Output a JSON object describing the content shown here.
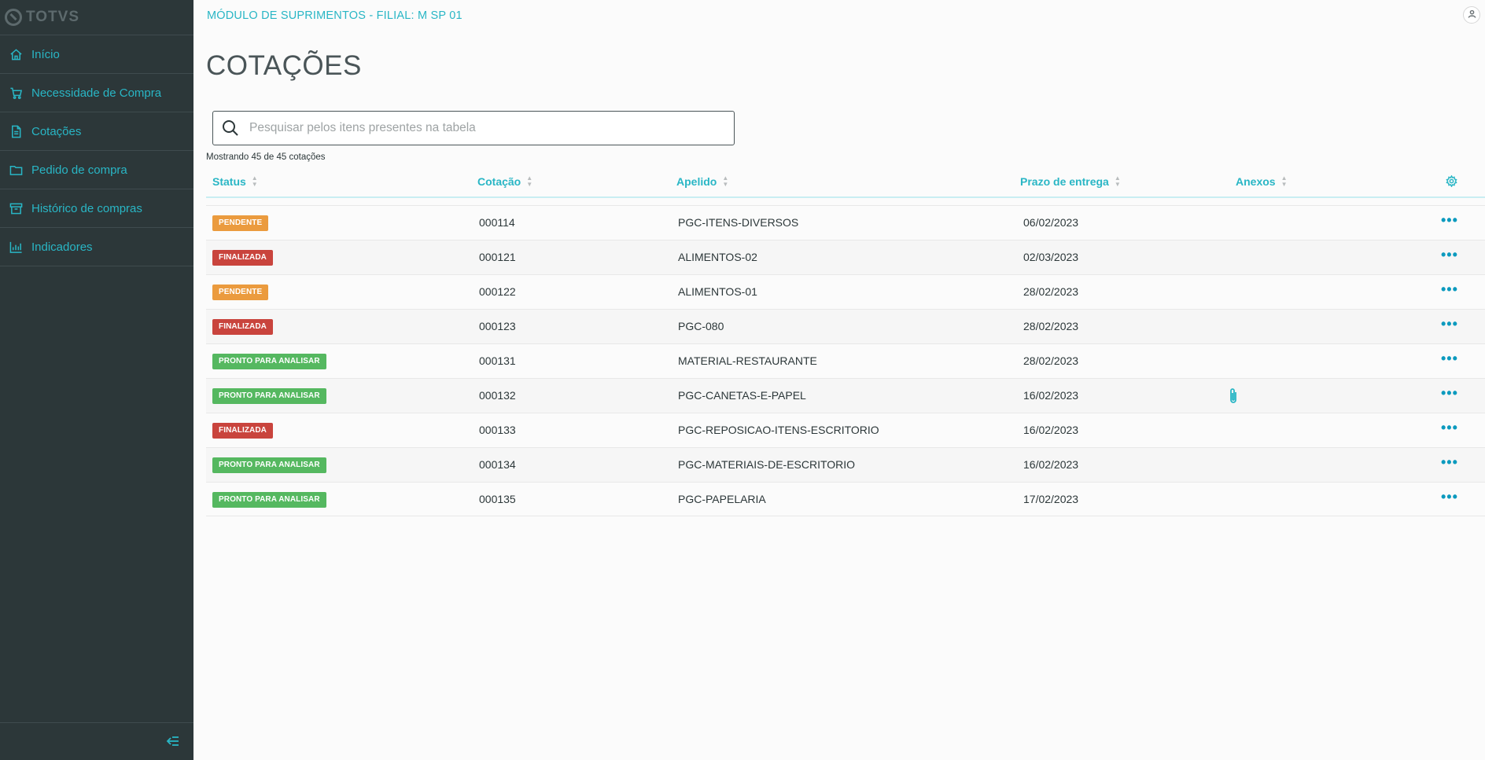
{
  "brand": {
    "name": "TOTVS"
  },
  "sidebar": {
    "items": [
      {
        "label": "Início",
        "icon": "home-icon"
      },
      {
        "label": "Necessidade de Compra",
        "icon": "cart-icon"
      },
      {
        "label": "Cotações",
        "icon": "document-icon"
      },
      {
        "label": "Pedido de compra",
        "icon": "folder-icon"
      },
      {
        "label": "Histórico de compras",
        "icon": "archive-icon"
      },
      {
        "label": "Indicadores",
        "icon": "bar-chart-icon"
      }
    ],
    "collapse_icon": "collapse-menu-icon"
  },
  "header": {
    "title": "MÓDULO DE SUPRIMENTOS - FILIAL: M SP 01",
    "user_icon": "user-icon"
  },
  "page": {
    "title": "COTAÇÕES",
    "search_placeholder": "Pesquisar pelos itens presentes na tabela",
    "search_value": "",
    "count_text": "Mostrando 45 de 45 cotações"
  },
  "table": {
    "columns": [
      "Status",
      "Cotação",
      "Apelido",
      "Prazo de entrega",
      "Anexos"
    ],
    "status_colors": {
      "PENDENTE": "#eb9b3e",
      "FINALIZADA": "#c9443d",
      "PRONTO PARA ANALISAR": "#55b860"
    },
    "rows": [
      {
        "status": "PENDENTE",
        "cotacao": "000114",
        "apelido": "PGC-ITENS-DIVERSOS",
        "prazo": "06/02/2023",
        "anexo": false
      },
      {
        "status": "FINALIZADA",
        "cotacao": "000121",
        "apelido": "ALIMENTOS-02",
        "prazo": "02/03/2023",
        "anexo": false
      },
      {
        "status": "PENDENTE",
        "cotacao": "000122",
        "apelido": "ALIMENTOS-01",
        "prazo": "28/02/2023",
        "anexo": false
      },
      {
        "status": "FINALIZADA",
        "cotacao": "000123",
        "apelido": "PGC-080",
        "prazo": "28/02/2023",
        "anexo": false
      },
      {
        "status": "PRONTO PARA ANALISAR",
        "cotacao": "000131",
        "apelido": "MATERIAL-RESTAURANTE",
        "prazo": "28/02/2023",
        "anexo": false
      },
      {
        "status": "PRONTO PARA ANALISAR",
        "cotacao": "000132",
        "apelido": "PGC-CANETAS-E-PAPEL",
        "prazo": "16/02/2023",
        "anexo": true
      },
      {
        "status": "FINALIZADA",
        "cotacao": "000133",
        "apelido": "PGC-REPOSICAO-ITENS-ESCRITORIO",
        "prazo": "16/02/2023",
        "anexo": false
      },
      {
        "status": "PRONTO PARA ANALISAR",
        "cotacao": "000134",
        "apelido": "PGC-MATERIAIS-DE-ESCRITORIO",
        "prazo": "16/02/2023",
        "anexo": false
      },
      {
        "status": "PRONTO PARA ANALISAR",
        "cotacao": "000135",
        "apelido": "PGC-PAPELARIA",
        "prazo": "17/02/2023",
        "anexo": false
      }
    ],
    "row_action_label": "•••"
  }
}
